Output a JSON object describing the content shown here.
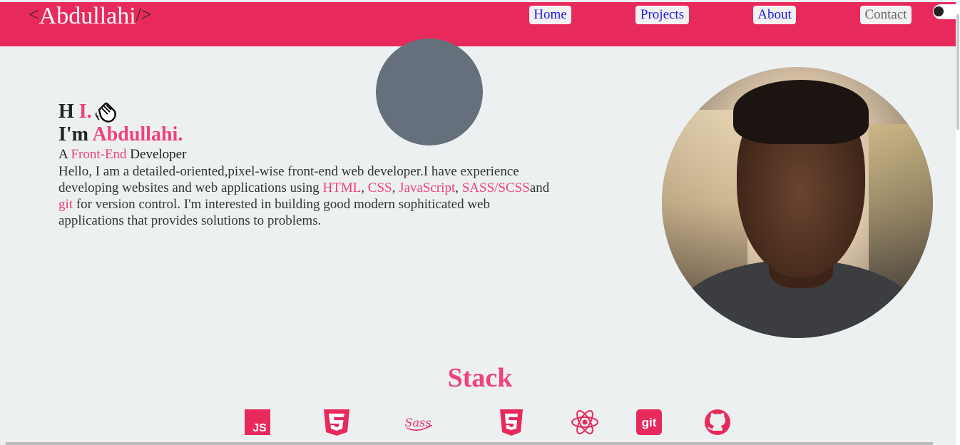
{
  "header": {
    "logo_open": "<",
    "logo_name": "Abdullahi",
    "logo_close": "/>",
    "nav": [
      {
        "label": "Home"
      },
      {
        "label": "Projects"
      },
      {
        "label": "About"
      },
      {
        "label": "Contact"
      }
    ],
    "theme_toggle_icon": "toggle-switch-icon"
  },
  "hero": {
    "greeting_h": "H",
    "greeting_i": "I.",
    "wave_icon": "waving-hand-icon",
    "im": "I'm",
    "name": "Abdullahi.",
    "role_prefix": "A",
    "role_highlight": "Front-End",
    "role_suffix": "Developer",
    "bio_1": "Hello, I am a detailed-oriented,pixel-wise front-end web developer.I have experience developing websites and web applications using",
    "html": "HTML",
    "comma1": ",",
    "css": "CSS",
    "comma2": ",",
    "js": "JavaScript",
    "comma3": ",",
    "sass": "SASS/SCSS",
    "and": "and",
    "git": "git",
    "bio_2": "for version control. I'm interested in building good modern sophiticated web applications that provides solutions to problems."
  },
  "stack": {
    "title": "Stack",
    "icons": [
      "javascript-icon",
      "css3-icon",
      "sass-icon",
      "html5-icon",
      "react-icon",
      "git-icon",
      "github-icon"
    ],
    "js_label": "JS",
    "sass_label": "Sass",
    "git_label": "git"
  },
  "colors": {
    "accent": "#e8295b",
    "pink_text": "#f0417b",
    "background": "#ecf0f1"
  }
}
